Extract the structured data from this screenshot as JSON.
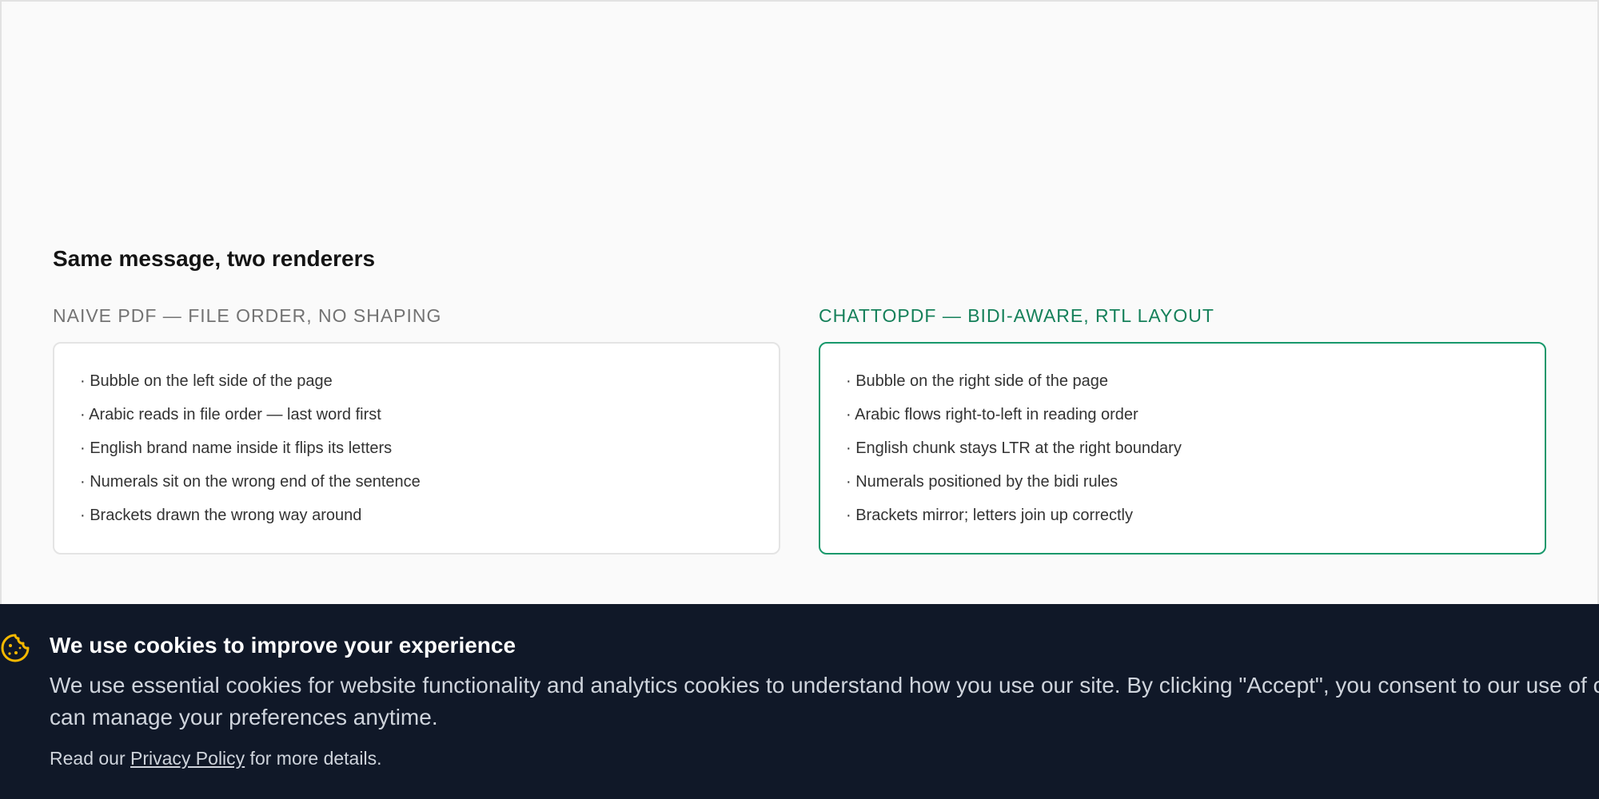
{
  "section": {
    "title": "Same message, two renderers"
  },
  "naive": {
    "label": "NAIVE PDF — FILE ORDER, NO SHAPING",
    "items": [
      "· Bubble on the left side of the page",
      "· Arabic reads in file order — last word first",
      "· English brand name inside it flips its letters",
      "· Numerals sit on the wrong end of the sentence",
      "· Brackets drawn the wrong way around"
    ]
  },
  "good": {
    "label": "CHATTOPDF — BIDI-AWARE, RTL LAYOUT",
    "items": [
      "· Bubble on the right side of the page",
      "· Arabic flows right-to-left in reading order",
      "· English chunk stays LTR at the right boundary",
      "· Numerals positioned by the bidi rules",
      "· Brackets mirror; letters join up correctly"
    ]
  },
  "cookie": {
    "icon": "cookie-icon",
    "title": "We use cookies to improve your experience",
    "text": "We use essential cookies for website functionality and analytics cookies to understand how you use our site. By clicking \"Accept\", you consent to our use of cookies. You can manage your preferences anytime.",
    "more_prefix": "Read our ",
    "policy_link": "Privacy Policy",
    "more_suffix": " for more details."
  },
  "colors": {
    "accent": "#18986b",
    "banner_bg": "#101828",
    "icon": "#f5b800"
  }
}
